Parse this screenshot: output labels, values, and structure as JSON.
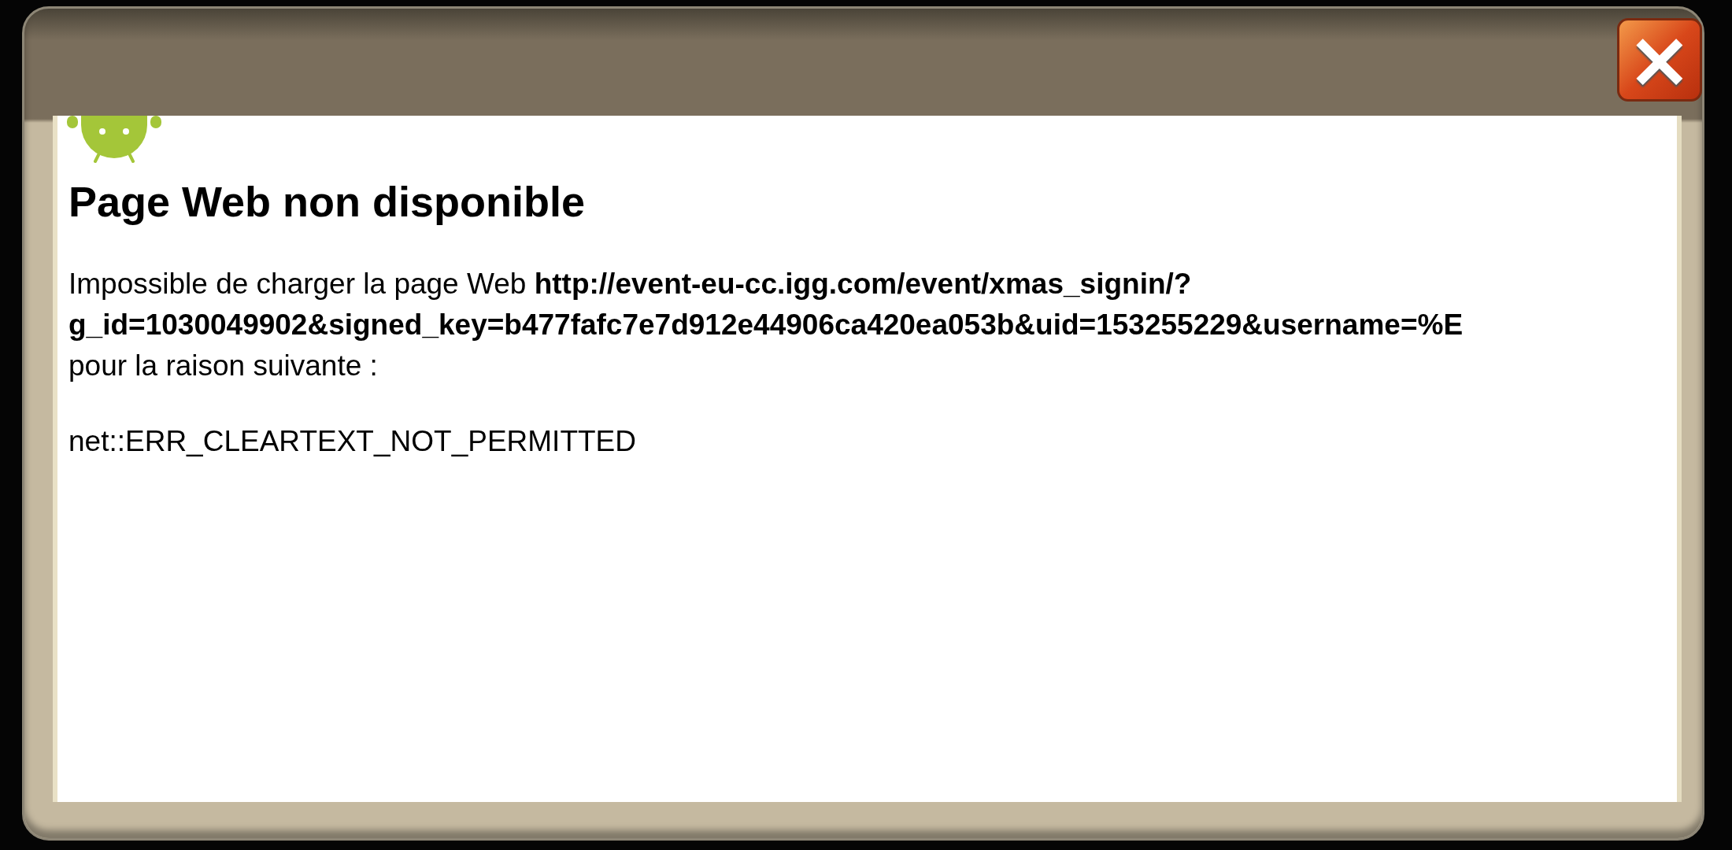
{
  "dialog": {
    "close_button": {
      "label": "×"
    },
    "page": {
      "title": "Page Web non disponible",
      "message": "Impossible de charger la page Web **http://event-eu-cc.igg.com/event/xmas_signin/?**\n**g_id=1030049902&signed_key=b477fafc7e7d912e44906ca420ea053b&uid=153255229&username=%E**\npour la raison suivante :",
      "error_code": "net::ERR_CLEARTEXT_NOT_PERMITTED"
    }
  }
}
